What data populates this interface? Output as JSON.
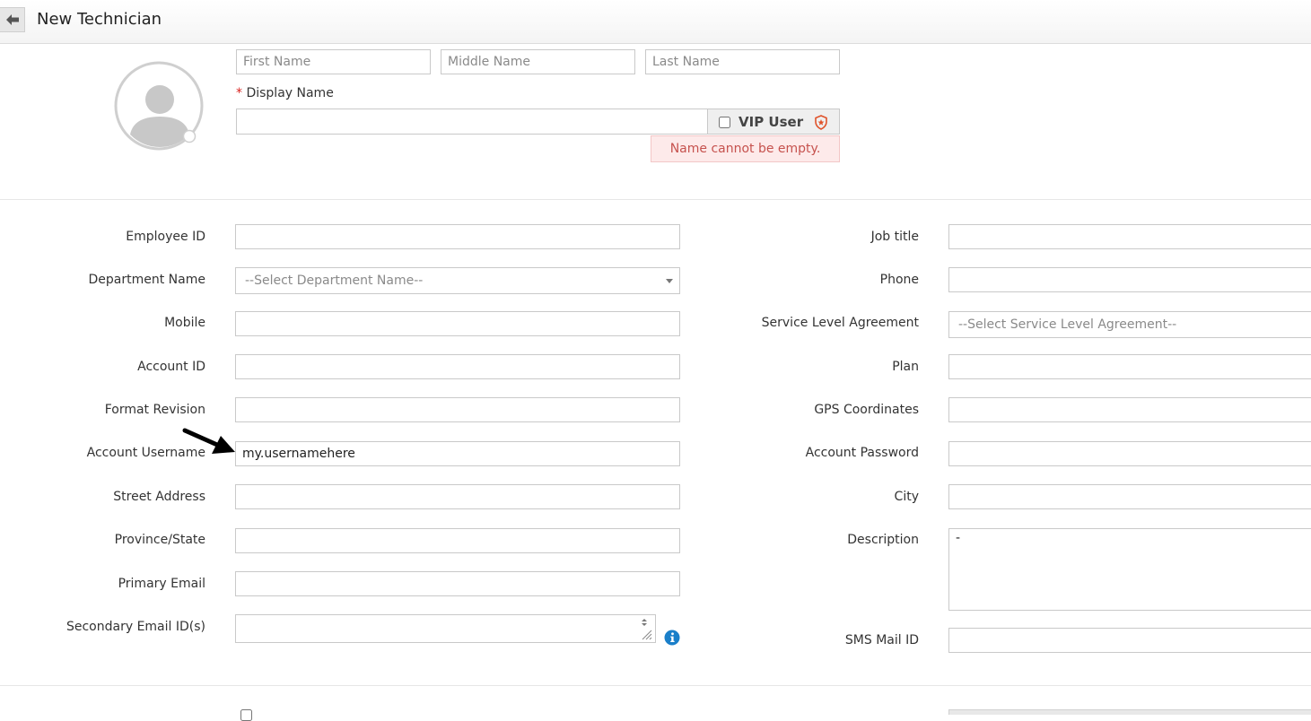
{
  "header": {
    "title": "New Technician",
    "back_icon": "back-arrow-icon"
  },
  "name": {
    "first_placeholder": "First Name",
    "middle_placeholder": "Middle Name",
    "last_placeholder": "Last Name",
    "display_label": "Display Name",
    "required_mark": "*",
    "display_value": "",
    "vip_label": "VIP User",
    "vip_checked": false,
    "error": "Name cannot be empty."
  },
  "left_fields": [
    {
      "label": "Employee ID",
      "value": ""
    },
    {
      "label": "Department Name",
      "placeholder": "--Select Department Name--"
    },
    {
      "label": "Mobile",
      "value": ""
    },
    {
      "label": "Account ID",
      "value": ""
    },
    {
      "label": "Format Revision",
      "value": ""
    },
    {
      "label": "Account Username",
      "value": "my.usernamehere"
    },
    {
      "label": "Street Address",
      "value": ""
    },
    {
      "label": "Province/State",
      "value": ""
    },
    {
      "label": "Primary Email",
      "value": ""
    },
    {
      "label": "Secondary Email ID(s)",
      "value": ""
    }
  ],
  "right_fields": [
    {
      "label": "Job title",
      "value": ""
    },
    {
      "label": "Phone",
      "value": ""
    },
    {
      "label": "Service Level Agreement",
      "placeholder": "--Select Service Level Agreement--"
    },
    {
      "label": "Plan",
      "value": ""
    },
    {
      "label": "GPS Coordinates",
      "value": ""
    },
    {
      "label": "Account Password",
      "value": ""
    },
    {
      "label": "City",
      "value": ""
    },
    {
      "label": "Description",
      "value": "-"
    },
    {
      "label": "SMS Mail ID",
      "value": ""
    }
  ],
  "colors": {
    "error_text": "#c6524e",
    "error_bg": "#fdeaea",
    "required": "#d9231f",
    "info": "#1a7fc9",
    "vip_icon": "#e0532b"
  }
}
